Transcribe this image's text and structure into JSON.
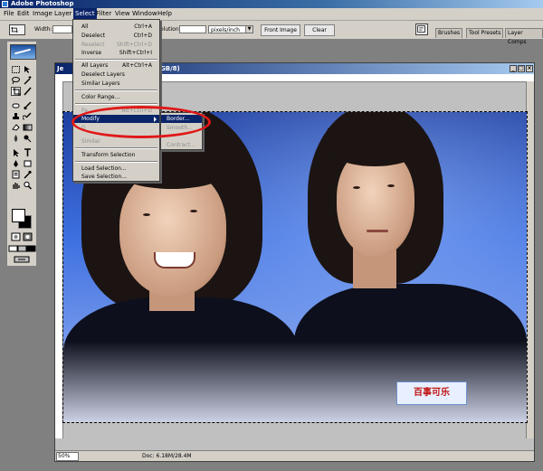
{
  "app": {
    "title": "Adobe Photoshop"
  },
  "menubar": [
    "File",
    "Edit",
    "Image",
    "Layer",
    "Select",
    "Filter",
    "View",
    "Window",
    "Help"
  ],
  "options": {
    "width_label": "Width:",
    "resolution_label": "olution:",
    "units_value": "pixels/inch",
    "front_image_label": "Front Image",
    "clear_label": "Clear"
  },
  "palette_tabs": [
    "Brushes",
    "Tool Presets",
    "Layer Comps"
  ],
  "document": {
    "title_visible_start": "Je",
    "title_visible_end": "GB/8)",
    "zoom": "50%",
    "doc_size": "Doc: 6.18M/28.4M",
    "badge_text": "百事可乐"
  },
  "select_menu": {
    "all": "All",
    "all_sc": "Ctrl+A",
    "deselect": "Deselect",
    "deselect_sc": "Ctrl+D",
    "reselect": "Reselect",
    "reselect_sc": "Shift+Ctrl+D",
    "inverse": "Inverse",
    "inverse_sc": "Shift+Ctrl+I",
    "all_layers": "All Layers",
    "all_layers_sc": "Alt+Ctrl+A",
    "deselect_layers": "Deselect Layers",
    "similar_layers": "Similar Layers",
    "color_range": "Color Range...",
    "feather_partial": "Fe",
    "feather_sc": "Alt+Ctrl+D",
    "modify": "Modify",
    "grow_partial": "G",
    "similar": "Similar",
    "transform_selection": "Transform Selection",
    "load_selection": "Load Selection...",
    "save_selection": "Save Selection..."
  },
  "modify_submenu": {
    "border": "Border...",
    "smooth": "Smooth...",
    "contract": "Contract..."
  },
  "colors": {
    "menu_highlight": "#0a246a",
    "annotation_ellipse": "#e01818",
    "chrome": "#d4d0c8"
  }
}
